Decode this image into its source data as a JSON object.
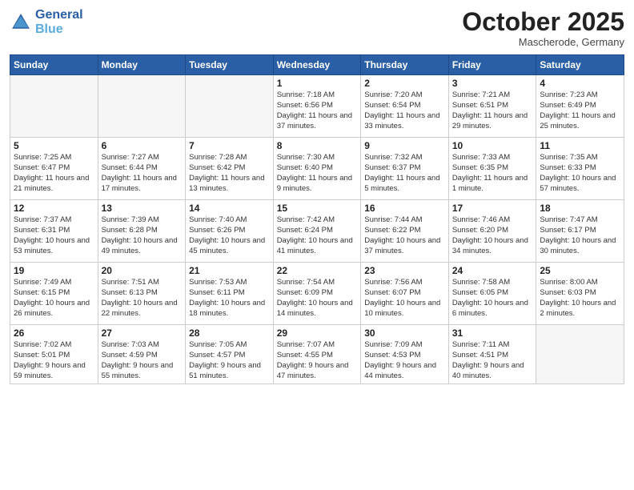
{
  "header": {
    "logo_line1": "General",
    "logo_line2": "Blue",
    "month": "October 2025",
    "location": "Mascherode, Germany"
  },
  "days_of_week": [
    "Sunday",
    "Monday",
    "Tuesday",
    "Wednesday",
    "Thursday",
    "Friday",
    "Saturday"
  ],
  "weeks": [
    [
      {
        "num": "",
        "info": ""
      },
      {
        "num": "",
        "info": ""
      },
      {
        "num": "",
        "info": ""
      },
      {
        "num": "1",
        "info": "Sunrise: 7:18 AM\nSunset: 6:56 PM\nDaylight: 11 hours and 37 minutes."
      },
      {
        "num": "2",
        "info": "Sunrise: 7:20 AM\nSunset: 6:54 PM\nDaylight: 11 hours and 33 minutes."
      },
      {
        "num": "3",
        "info": "Sunrise: 7:21 AM\nSunset: 6:51 PM\nDaylight: 11 hours and 29 minutes."
      },
      {
        "num": "4",
        "info": "Sunrise: 7:23 AM\nSunset: 6:49 PM\nDaylight: 11 hours and 25 minutes."
      }
    ],
    [
      {
        "num": "5",
        "info": "Sunrise: 7:25 AM\nSunset: 6:47 PM\nDaylight: 11 hours and 21 minutes."
      },
      {
        "num": "6",
        "info": "Sunrise: 7:27 AM\nSunset: 6:44 PM\nDaylight: 11 hours and 17 minutes."
      },
      {
        "num": "7",
        "info": "Sunrise: 7:28 AM\nSunset: 6:42 PM\nDaylight: 11 hours and 13 minutes."
      },
      {
        "num": "8",
        "info": "Sunrise: 7:30 AM\nSunset: 6:40 PM\nDaylight: 11 hours and 9 minutes."
      },
      {
        "num": "9",
        "info": "Sunrise: 7:32 AM\nSunset: 6:37 PM\nDaylight: 11 hours and 5 minutes."
      },
      {
        "num": "10",
        "info": "Sunrise: 7:33 AM\nSunset: 6:35 PM\nDaylight: 11 hours and 1 minute."
      },
      {
        "num": "11",
        "info": "Sunrise: 7:35 AM\nSunset: 6:33 PM\nDaylight: 10 hours and 57 minutes."
      }
    ],
    [
      {
        "num": "12",
        "info": "Sunrise: 7:37 AM\nSunset: 6:31 PM\nDaylight: 10 hours and 53 minutes."
      },
      {
        "num": "13",
        "info": "Sunrise: 7:39 AM\nSunset: 6:28 PM\nDaylight: 10 hours and 49 minutes."
      },
      {
        "num": "14",
        "info": "Sunrise: 7:40 AM\nSunset: 6:26 PM\nDaylight: 10 hours and 45 minutes."
      },
      {
        "num": "15",
        "info": "Sunrise: 7:42 AM\nSunset: 6:24 PM\nDaylight: 10 hours and 41 minutes."
      },
      {
        "num": "16",
        "info": "Sunrise: 7:44 AM\nSunset: 6:22 PM\nDaylight: 10 hours and 37 minutes."
      },
      {
        "num": "17",
        "info": "Sunrise: 7:46 AM\nSunset: 6:20 PM\nDaylight: 10 hours and 34 minutes."
      },
      {
        "num": "18",
        "info": "Sunrise: 7:47 AM\nSunset: 6:17 PM\nDaylight: 10 hours and 30 minutes."
      }
    ],
    [
      {
        "num": "19",
        "info": "Sunrise: 7:49 AM\nSunset: 6:15 PM\nDaylight: 10 hours and 26 minutes."
      },
      {
        "num": "20",
        "info": "Sunrise: 7:51 AM\nSunset: 6:13 PM\nDaylight: 10 hours and 22 minutes."
      },
      {
        "num": "21",
        "info": "Sunrise: 7:53 AM\nSunset: 6:11 PM\nDaylight: 10 hours and 18 minutes."
      },
      {
        "num": "22",
        "info": "Sunrise: 7:54 AM\nSunset: 6:09 PM\nDaylight: 10 hours and 14 minutes."
      },
      {
        "num": "23",
        "info": "Sunrise: 7:56 AM\nSunset: 6:07 PM\nDaylight: 10 hours and 10 minutes."
      },
      {
        "num": "24",
        "info": "Sunrise: 7:58 AM\nSunset: 6:05 PM\nDaylight: 10 hours and 6 minutes."
      },
      {
        "num": "25",
        "info": "Sunrise: 8:00 AM\nSunset: 6:03 PM\nDaylight: 10 hours and 2 minutes."
      }
    ],
    [
      {
        "num": "26",
        "info": "Sunrise: 7:02 AM\nSunset: 5:01 PM\nDaylight: 9 hours and 59 minutes."
      },
      {
        "num": "27",
        "info": "Sunrise: 7:03 AM\nSunset: 4:59 PM\nDaylight: 9 hours and 55 minutes."
      },
      {
        "num": "28",
        "info": "Sunrise: 7:05 AM\nSunset: 4:57 PM\nDaylight: 9 hours and 51 minutes."
      },
      {
        "num": "29",
        "info": "Sunrise: 7:07 AM\nSunset: 4:55 PM\nDaylight: 9 hours and 47 minutes."
      },
      {
        "num": "30",
        "info": "Sunrise: 7:09 AM\nSunset: 4:53 PM\nDaylight: 9 hours and 44 minutes."
      },
      {
        "num": "31",
        "info": "Sunrise: 7:11 AM\nSunset: 4:51 PM\nDaylight: 9 hours and 40 minutes."
      },
      {
        "num": "",
        "info": ""
      }
    ]
  ]
}
